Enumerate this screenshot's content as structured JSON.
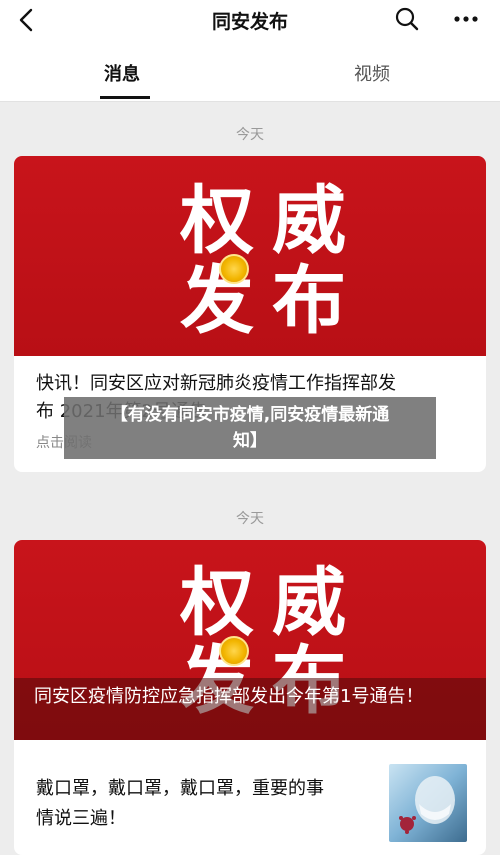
{
  "header": {
    "title": "同安发布",
    "back_icon": "chevron-left-icon",
    "search_icon": "search-icon",
    "more_icon": "more-dots-icon"
  },
  "tabs": [
    {
      "label": "消息",
      "active": true
    },
    {
      "label": "视频",
      "active": false
    }
  ],
  "feed": [
    {
      "date": "今天",
      "banner_title": [
        "权威",
        "发布"
      ],
      "article_title": "快讯！同安区应对新冠肺炎疫情工作指挥部发布2021年第2号通告",
      "article_line1": "快讯！同安区应对新冠肺炎疫情工作指挥部发",
      "article_line2": "布 2021年第2号通告",
      "read_label": "点击阅读"
    },
    {
      "date": "今天",
      "banner_title": [
        "权威",
        "发布"
      ],
      "banner_caption": "同安区疫情防控应急指挥部发出今年第1号通告！",
      "sub_article_line1": "戴口罩，戴口罩，戴口罩，重要的事",
      "sub_article_line2": "情说三遍！",
      "thumb_icon": "mask-illustration-icon"
    }
  ],
  "overlay": {
    "line1": "【有没有同安市疫情,同安疫情最新通",
    "line2": "知】"
  },
  "colors": {
    "banner_red": "#c8141b",
    "background": "#ededed",
    "card": "#ffffff"
  }
}
